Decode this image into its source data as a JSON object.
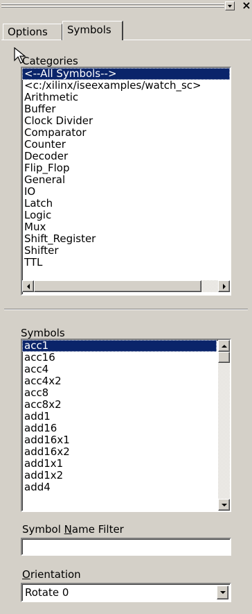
{
  "tabs": [
    {
      "label": "Options",
      "active": false
    },
    {
      "label": "Symbols",
      "active": true
    }
  ],
  "categories": {
    "label": "Categories",
    "items": [
      "<--All Symbols-->",
      "<c:/xilinx/iseexamples/watch_sc>",
      "Arithmetic",
      "Buffer",
      "Clock Divider",
      "Comparator",
      "Counter",
      "Decoder",
      "Flip_Flop",
      "General",
      "IO",
      "Latch",
      "Logic",
      "Mux",
      "Shift_Register",
      "Shifter",
      "TTL"
    ],
    "selected_index": 0
  },
  "symbols": {
    "label": "Symbols",
    "items": [
      "acc1",
      "acc16",
      "acc4",
      "acc4x2",
      "acc8",
      "acc8x2",
      "add1",
      "add16",
      "add16x1",
      "add16x2",
      "add1x1",
      "add1x2",
      "add4"
    ],
    "selected_index": 0
  },
  "name_filter": {
    "label_pre": "Symbol ",
    "label_ul": "N",
    "label_post": "ame Filter",
    "value": ""
  },
  "orientation": {
    "label_ul": "O",
    "label_post": "rientation",
    "value": "Rotate 0"
  },
  "colors": {
    "face": "#d4d0c8",
    "selection": "#0a246a"
  }
}
